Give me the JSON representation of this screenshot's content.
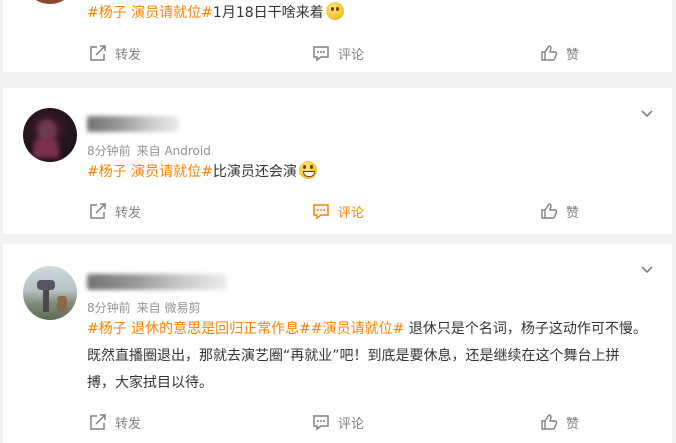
{
  "posts": [
    {
      "content_tag": "#杨子 演员请就位#",
      "content_text": "1月18日干啥来着",
      "emoji": "thinking-emoji",
      "actions": {
        "repost": "转发",
        "comment": "评论",
        "like": "赞"
      }
    },
    {
      "username": "...",
      "time": "8分钟前",
      "source": "来自 Android",
      "content_tag": "#杨子 演员请就位#",
      "content_text": "比演员还会演",
      "emoji": "grin-emoji",
      "actions": {
        "repost": "转发",
        "comment": "评论",
        "like": "赞"
      }
    },
    {
      "username": "...",
      "time": "8分钟前",
      "source": "来自 微易剪",
      "content_tag": "#杨子 退休的意思是回归正常作息##演员请就位#",
      "content_text": " 退休只是个名词，杨子这动作可不慢。既然直播圈退出，那就去演艺圈“再就业”吧！到底是要休息，还是继续在这个舞台上拼搏，大家拭目以待。",
      "actions": {
        "repost": "转发",
        "comment": "评论",
        "like": "赞"
      }
    }
  ],
  "colors": {
    "tag": "#ff8200",
    "meta": "#939393",
    "action": "#808080",
    "active": "#ff8200"
  },
  "icons": {
    "repost": "share-icon",
    "comment": "comment-icon",
    "like": "thumbs-up-icon",
    "more": "chevron-down-icon"
  }
}
